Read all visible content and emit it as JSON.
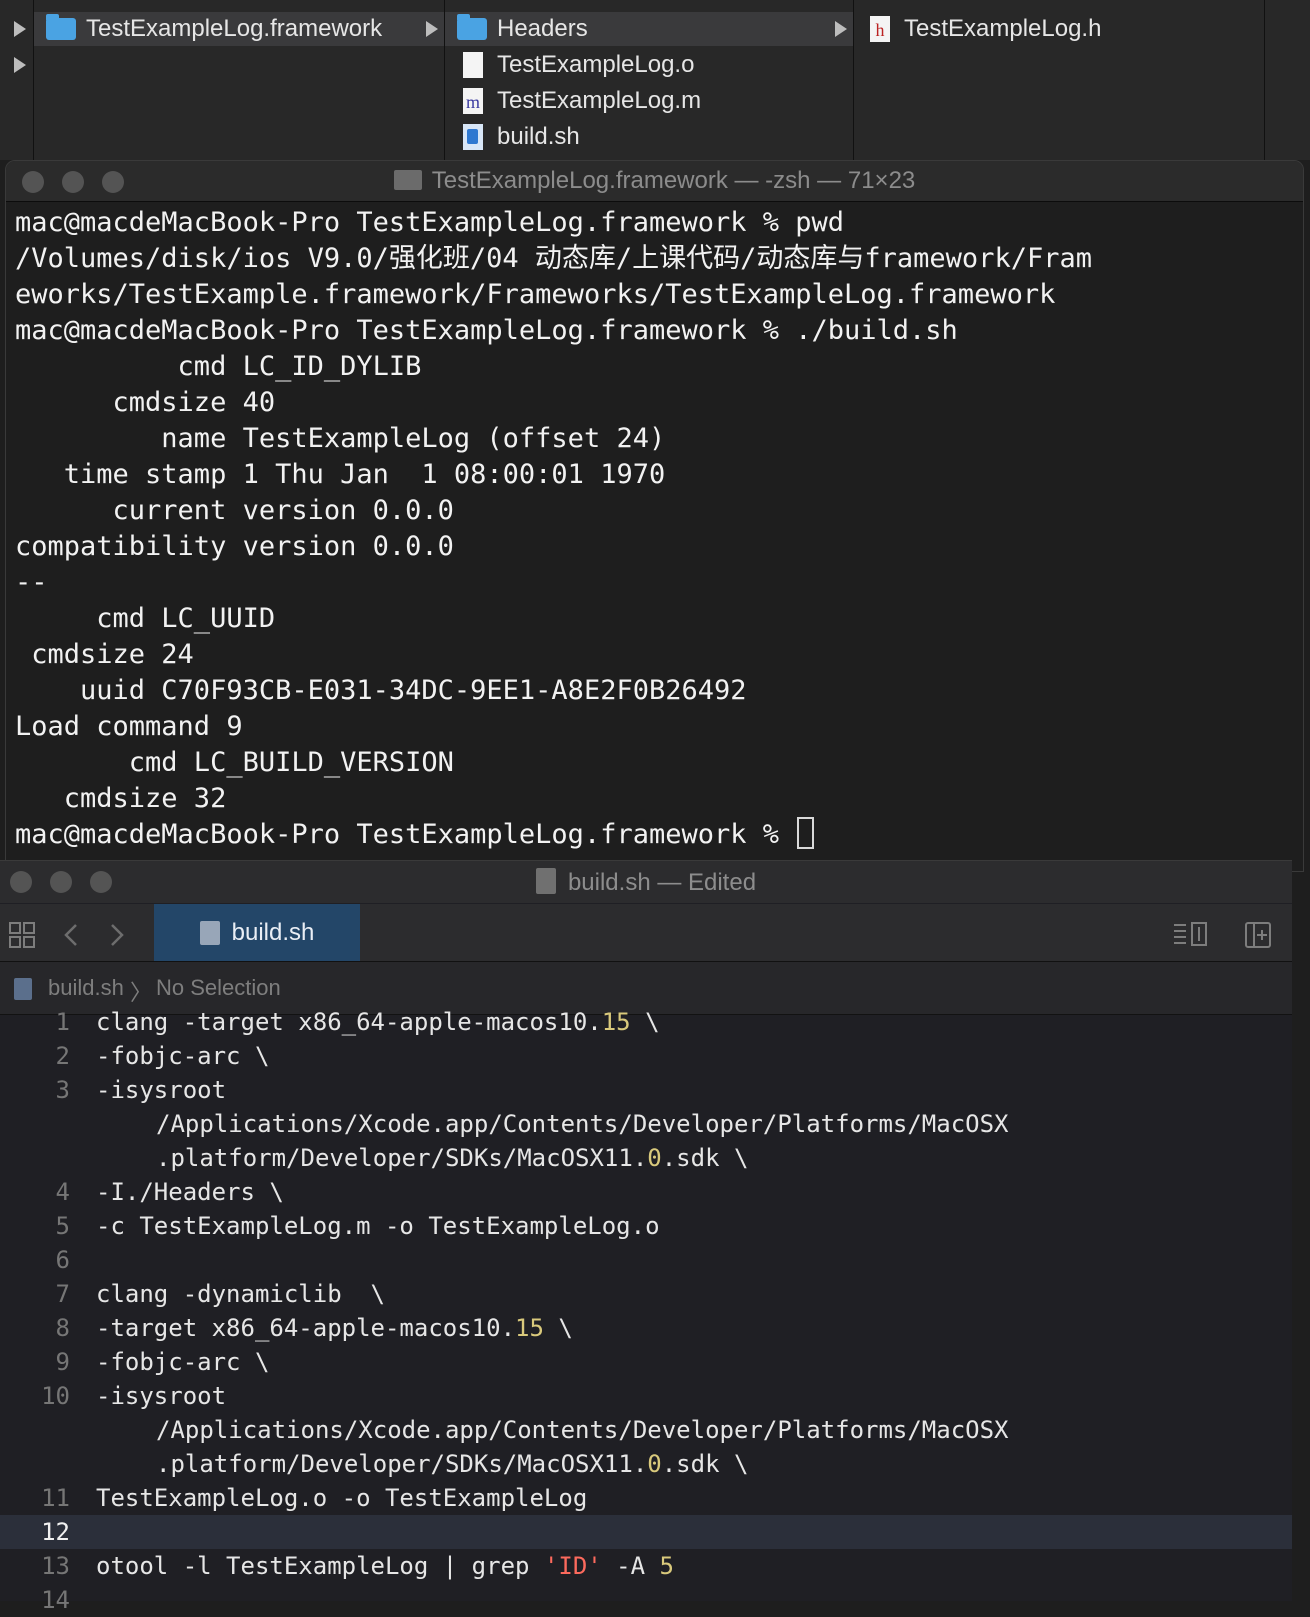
{
  "finder": {
    "col1": {
      "folder_label": "TestExampleLog.framework"
    },
    "col2": {
      "items": [
        "Headers",
        "TestExampleLog.o",
        "TestExampleLog.m",
        "build.sh"
      ]
    },
    "col3": {
      "items": [
        "TestExampleLog.h"
      ]
    }
  },
  "terminal": {
    "title": "TestExampleLog.framework — -zsh — 71×23",
    "lines": [
      "mac@macdeMacBook-Pro TestExampleLog.framework % pwd",
      "/Volumes/disk/ios V9.0/强化班/04 动态库/上课代码/动态库与framework/Fram",
      "eworks/TestExample.framework/Frameworks/TestExampleLog.framework",
      "mac@macdeMacBook-Pro TestExampleLog.framework % ./build.sh",
      "          cmd LC_ID_DYLIB",
      "      cmdsize 40",
      "         name TestExampleLog (offset 24)",
      "   time stamp 1 Thu Jan  1 08:00:01 1970",
      "      current version 0.0.0",
      "compatibility version 0.0.0",
      "--",
      "     cmd LC_UUID",
      " cmdsize 24",
      "    uuid C70F93CB-E031-34DC-9EE1-A8E2F0B26492",
      "Load command 9",
      "       cmd LC_BUILD_VERSION",
      "   cmdsize 32",
      "mac@macdeMacBook-Pro TestExampleLog.framework % "
    ]
  },
  "xcode": {
    "title": "build.sh — Edited",
    "tab": "build.sh",
    "jump": {
      "file": "build.sh",
      "sep": "〉",
      "selection": "No Selection"
    },
    "lines": [
      {
        "n": "1",
        "text": "clang -target x86_64-apple-macos10.15 \\"
      },
      {
        "n": "2",
        "text": "-fobjc-arc \\"
      },
      {
        "n": "3",
        "text": "-isysroot"
      },
      {
        "n": "",
        "text": "/Applications/Xcode.app/Contents/Developer/Platforms/MacOSX"
      },
      {
        "n": "",
        "text": ".platform/Developer/SDKs/MacOSX11.0.sdk \\"
      },
      {
        "n": "4",
        "text": "-I./Headers \\"
      },
      {
        "n": "5",
        "text": "-c TestExampleLog.m -o TestExampleLog.o"
      },
      {
        "n": "6",
        "text": ""
      },
      {
        "n": "7",
        "text": "clang -dynamiclib  \\"
      },
      {
        "n": "8",
        "text": "-target x86_64-apple-macos10.15 \\"
      },
      {
        "n": "9",
        "text": "-fobjc-arc \\"
      },
      {
        "n": "10",
        "text": "-isysroot"
      },
      {
        "n": "",
        "text": "/Applications/Xcode.app/Contents/Developer/Platforms/MacOSX"
      },
      {
        "n": "",
        "text": ".platform/Developer/SDKs/MacOSX11.0.sdk \\"
      },
      {
        "n": "11",
        "text": "TestExampleLog.o -o TestExampleLog"
      },
      {
        "n": "12",
        "text": ""
      },
      {
        "n": "13",
        "text": "otool -l TestExampleLog | grep 'ID' -A 5"
      },
      {
        "n": "14",
        "text": ""
      }
    ]
  }
}
